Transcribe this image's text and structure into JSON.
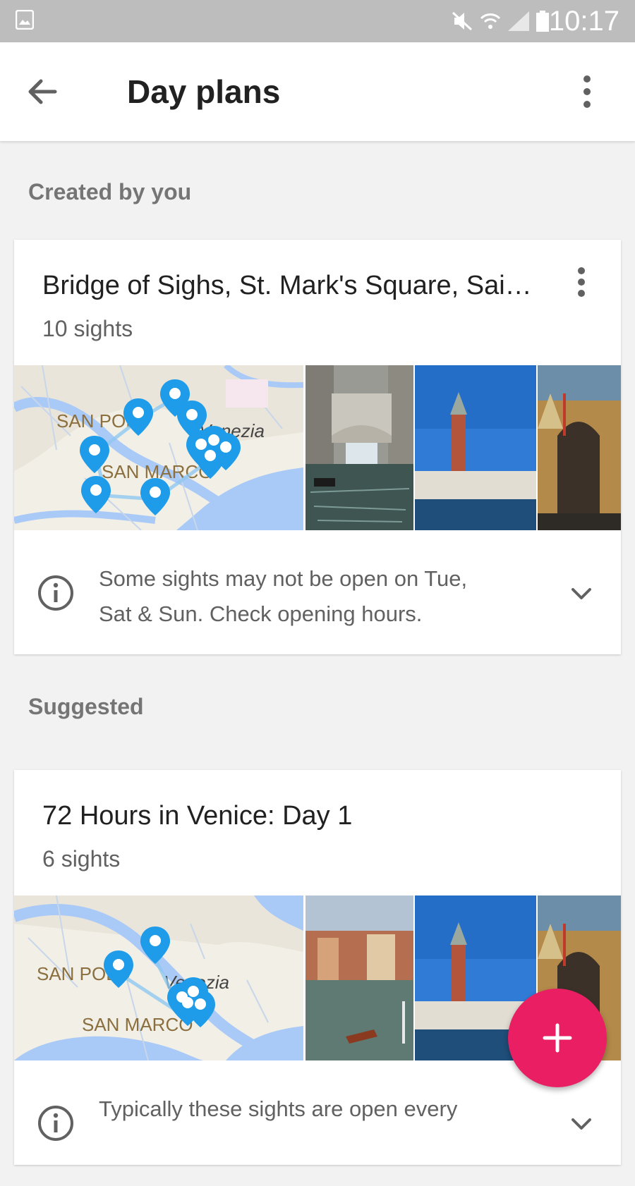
{
  "status_bar": {
    "time": "10:17"
  },
  "app_bar": {
    "title": "Day plans"
  },
  "sections": {
    "created": "Created by you",
    "suggested": "Suggested"
  },
  "created_plan": {
    "title": "Bridge of Sighs, St. Mark's Square, Sai…",
    "sights": "10 sights",
    "map_labels": [
      "SAN POLO",
      "SAN MARCO",
      "Venezia"
    ],
    "info_line1": "Some sights may not be open on Tue,",
    "info_line2": "Sat & Sun. Check opening hours."
  },
  "suggested_plan": {
    "title": "72 Hours in Venice: Day 1",
    "sights": "6 sights",
    "map_labels": [
      "SAN POLO",
      "SAN MARCO",
      "Venezia"
    ],
    "info_line1": "Typically these sights are open every"
  },
  "colors": {
    "fab": "#e91e63",
    "pin": "#1e9be9",
    "map_water": "#a9c9f7",
    "map_land": "#f1efe6"
  },
  "icons": {
    "back": "arrow-back-icon",
    "overflow": "more-vert-icon",
    "info": "info-icon",
    "expand": "chevron-down-icon",
    "fab": "plus-icon"
  }
}
